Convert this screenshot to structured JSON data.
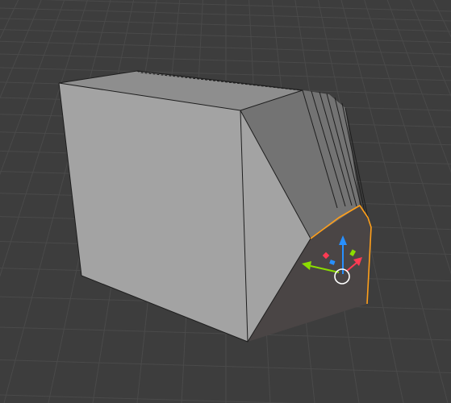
{
  "viewport": {
    "background_color": "#3d3d3d",
    "grid_color": "#4a4a4a",
    "mode": "edit"
  },
  "mesh": {
    "face_light_color": "#a3a3a3",
    "face_mid_color": "#8e8e8e",
    "face_dark_color": "#737373",
    "selected_face_color": "#4a4545",
    "selection_outline_color": "#ff9f1a",
    "edge_color": "#1e1e1e",
    "bevel_segment_count": 6
  },
  "gizmo": {
    "name": "transform-gizmo",
    "axes": [
      {
        "name": "x-axis",
        "color": "#ff3b53"
      },
      {
        "name": "y-axis",
        "color": "#8bdc00"
      },
      {
        "name": "z-axis",
        "color": "#2890ff"
      }
    ],
    "center_ring_color": "#ffffff"
  }
}
